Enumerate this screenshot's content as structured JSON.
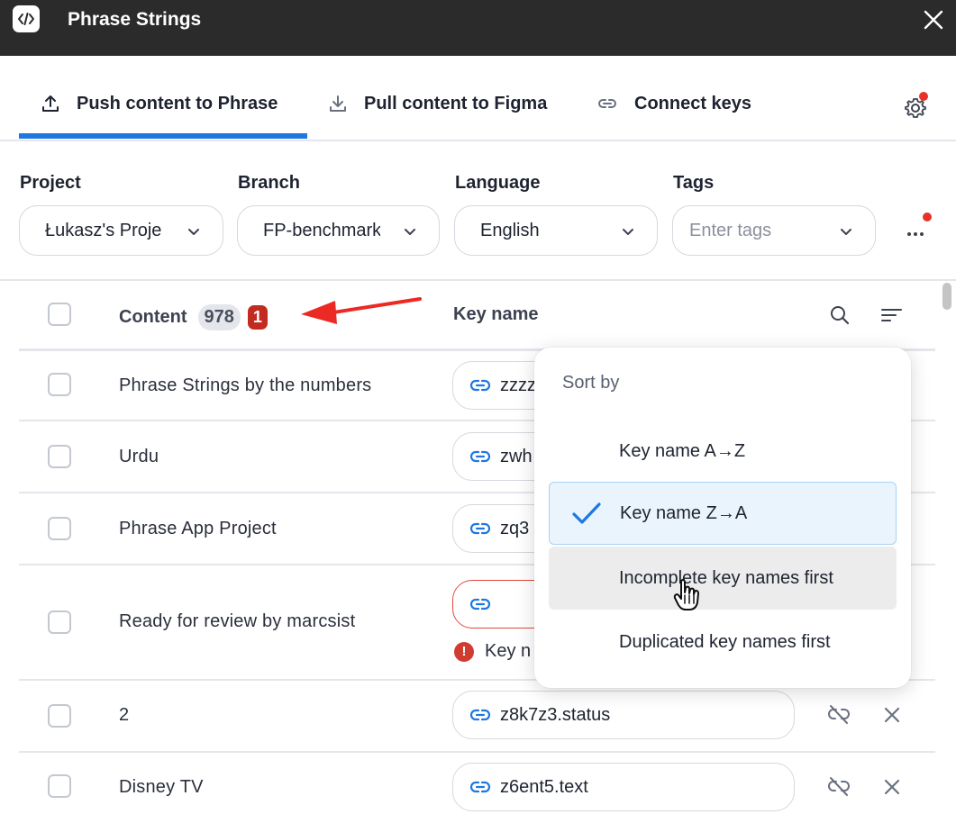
{
  "window": {
    "title": "Phrase Strings",
    "icon": "code-brackets-icon"
  },
  "tabs": [
    {
      "label": "Push content to Phrase",
      "icon": "upload-icon",
      "active": true
    },
    {
      "label": "Pull content to Figma",
      "icon": "download-icon",
      "active": false
    },
    {
      "label": "Connect keys",
      "icon": "link-icon",
      "active": false
    }
  ],
  "filters": {
    "project": {
      "label": "Project",
      "value": "Łukasz's Project"
    },
    "branch": {
      "label": "Branch",
      "value": "FP-benchmark"
    },
    "language": {
      "label": "Language",
      "value": "English"
    },
    "tags": {
      "label": "Tags",
      "placeholder": "Enter tags"
    }
  },
  "table": {
    "header": {
      "content_label": "Content",
      "content_count": "978",
      "issue_count": "1",
      "key_label": "Key name"
    },
    "rows": [
      {
        "content": "Phrase Strings by the numbers",
        "key": "zzzz"
      },
      {
        "content": "Urdu",
        "key": "zwh"
      },
      {
        "content": "Phrase App Project",
        "key": "zq3"
      },
      {
        "content": "Ready for review by marcsist",
        "key": "",
        "error": "Key n"
      },
      {
        "content": "2",
        "key": "z8k7z3.status"
      },
      {
        "content": "Disney TV",
        "key": "z6ent5.text"
      }
    ]
  },
  "sort_menu": {
    "title": "Sort by",
    "options": [
      {
        "label": "Key name A→Z",
        "selected": false
      },
      {
        "label": "Key name Z→A",
        "selected": true
      },
      {
        "label": "Incomplete key names first",
        "selected": false,
        "hovered": true
      },
      {
        "label": "Duplicated key names first",
        "selected": false
      }
    ]
  },
  "colors": {
    "accent": "#1f78e0",
    "titlebar": "#2b2b2b",
    "error": "#d13c30",
    "badge": "#c22b20",
    "notification_dot": "#e5332a"
  }
}
